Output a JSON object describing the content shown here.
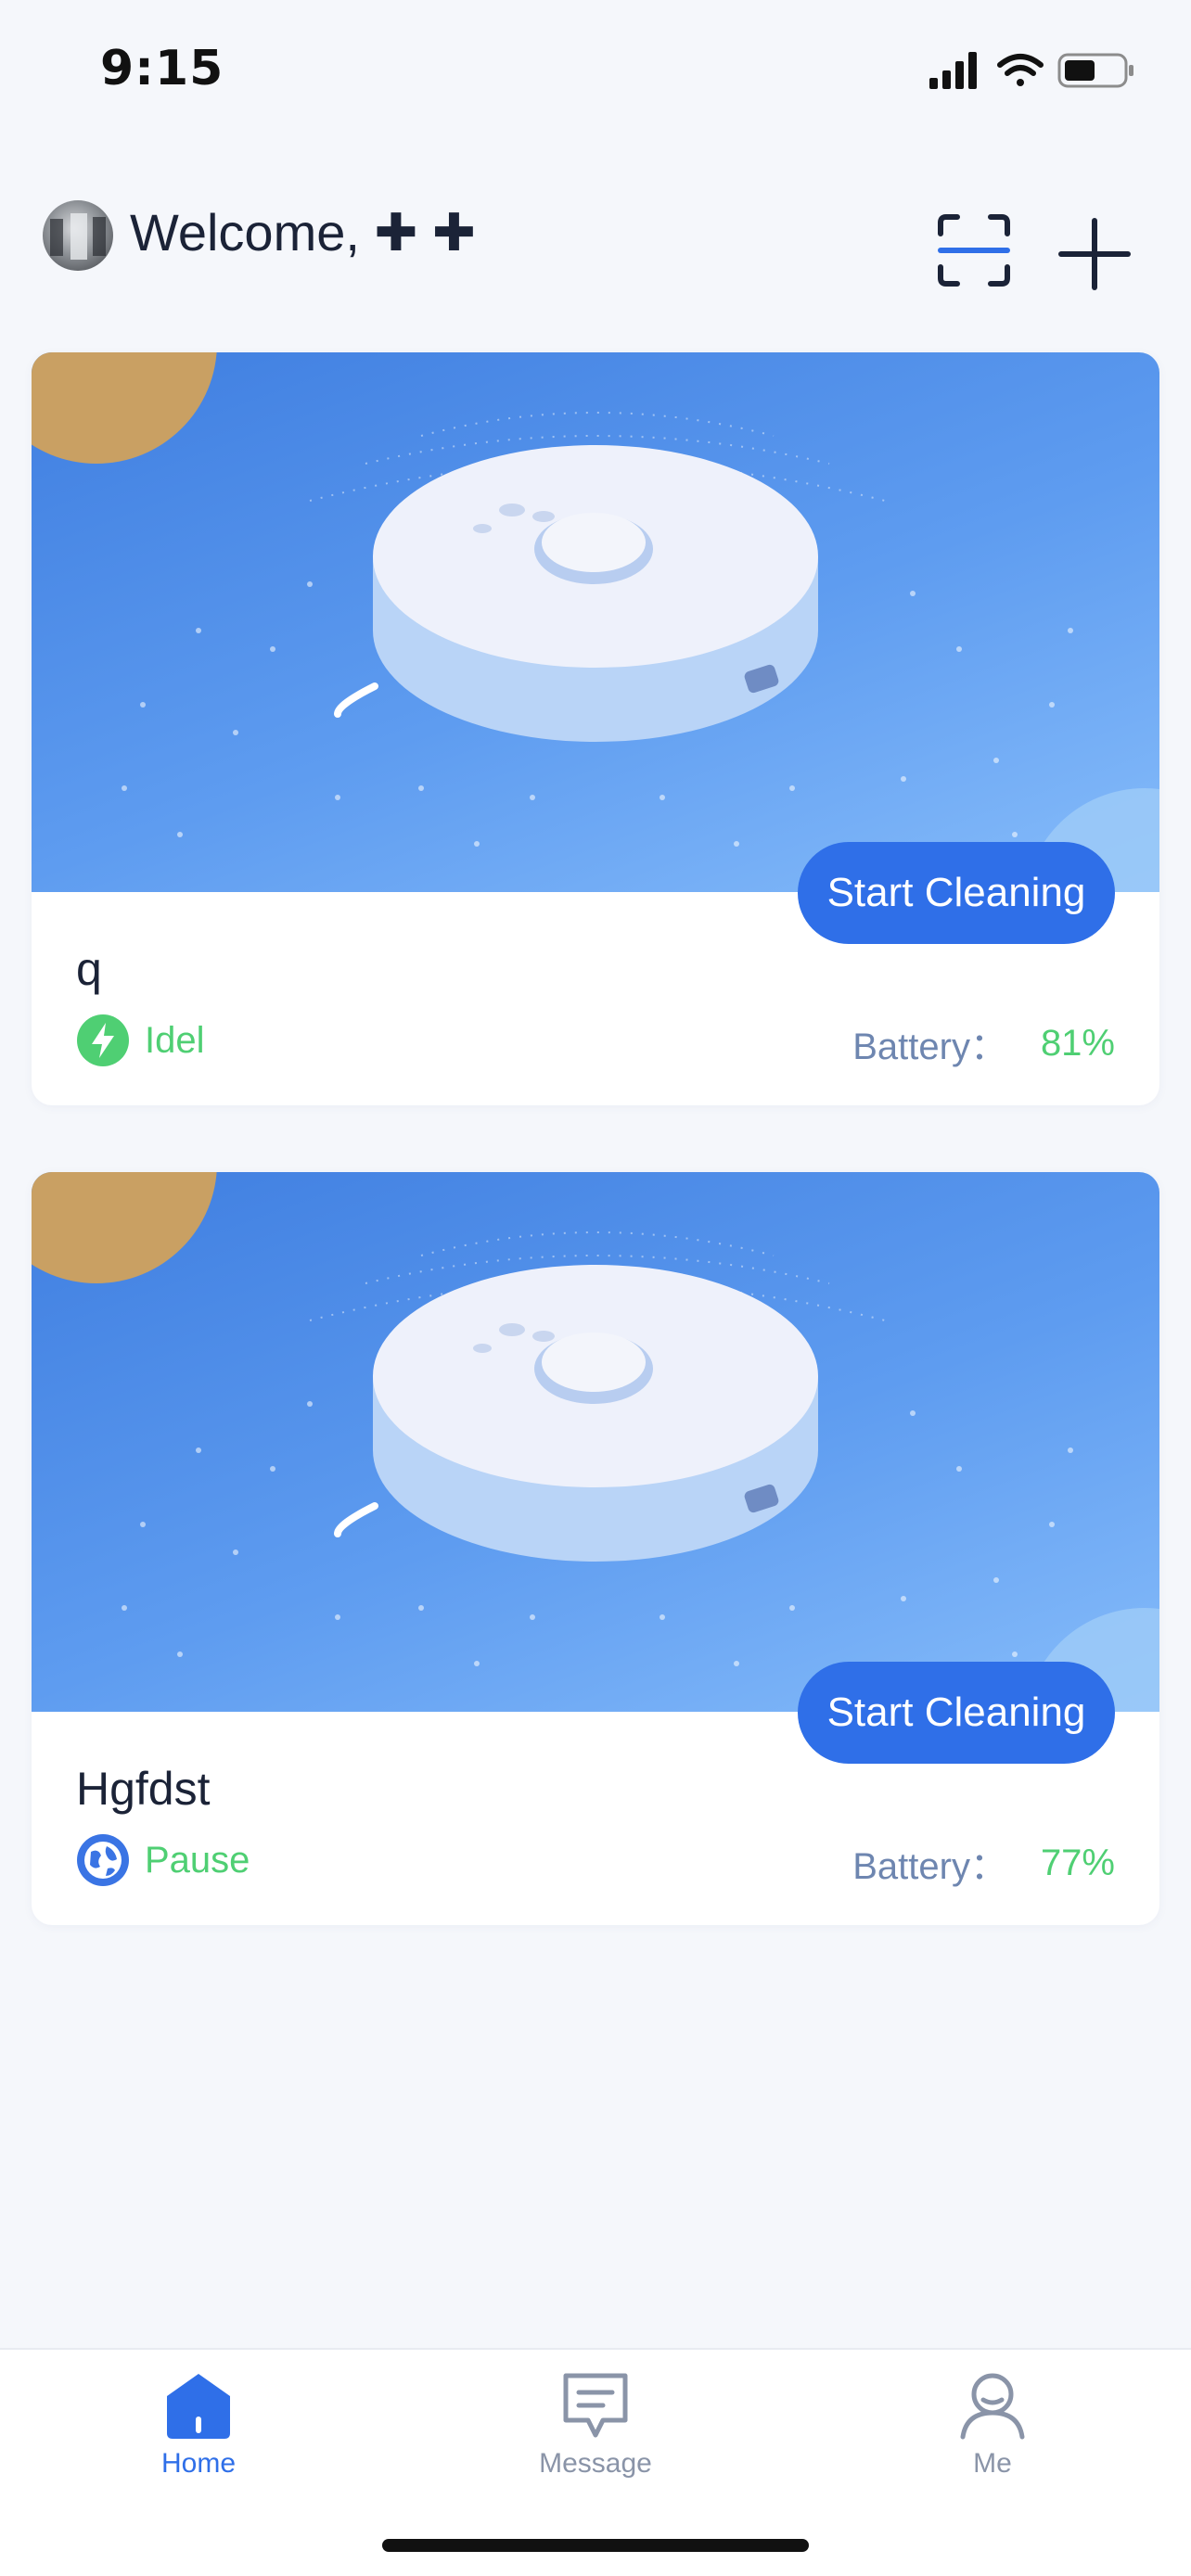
{
  "status_bar": {
    "time": "9:15",
    "icons": [
      "signal-icon",
      "wifi-icon",
      "battery-icon"
    ]
  },
  "header": {
    "welcome": "Welcome, ✚ ✚",
    "scan_icon": "scan-icon",
    "add_icon": "plus-icon"
  },
  "devices": [
    {
      "name": "q",
      "status": "Idel",
      "status_icon": "lightning-icon",
      "status_icon_color": "#4fcf73",
      "battery_label": "Battery：",
      "battery_value": "81%",
      "button_label": "Start Cleaning"
    },
    {
      "name": "Hgfdst",
      "status": "Pause",
      "status_icon": "globe-icon",
      "status_icon_color": "#3a74e4",
      "battery_label": "Battery：",
      "battery_value": "77%",
      "button_label": "Start Cleaning"
    }
  ],
  "tabbar": {
    "tabs": [
      {
        "label": "Home",
        "icon": "home-icon",
        "active": true
      },
      {
        "label": "Message",
        "icon": "message-icon",
        "active": false
      },
      {
        "label": "Me",
        "icon": "person-icon",
        "active": false
      }
    ],
    "active_color": "#2f6fe8",
    "inactive_color": "#8a94a8"
  }
}
